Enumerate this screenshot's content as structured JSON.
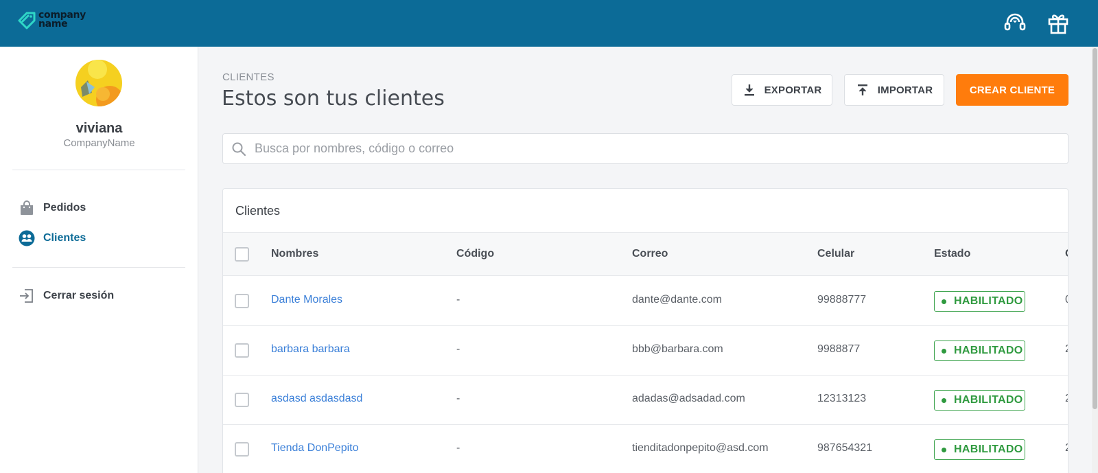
{
  "header": {
    "logo_line1": "company",
    "logo_line2": "name",
    "support_icon": "headset-icon",
    "gift_icon": "gift-icon",
    "bg_color": "#0c6b97"
  },
  "sidebar": {
    "user_name": "viviana",
    "company": "CompanyName",
    "items": [
      {
        "label": "Pedidos",
        "icon": "shopping-bag-icon"
      },
      {
        "label": "Clientes",
        "icon": "users-icon",
        "active": true
      },
      {
        "label": "Cerrar sesión",
        "icon": "logout-icon"
      }
    ]
  },
  "main": {
    "breadcrumb": "CLIENTES",
    "title": "Estos son tus clientes",
    "buttons": {
      "export": "EXPORTAR",
      "import": "IMPORTAR",
      "create": "CREAR CLIENTE"
    },
    "search_placeholder": "Busca por nombres, código o correo",
    "accent_color": "#ff7c0c"
  },
  "table": {
    "title": "Clientes",
    "columns": [
      "Nombres",
      "Código",
      "Correo",
      "Celular",
      "Estado",
      "C"
    ],
    "rows": [
      {
        "name": "Dante Morales",
        "code": "-",
        "email": "dante@dante.com",
        "phone": "99888777",
        "status": "HABILITADO",
        "extra": "0"
      },
      {
        "name": "barbara barbara",
        "code": "-",
        "email": "bbb@barbara.com",
        "phone": "9988877",
        "status": "HABILITADO",
        "extra": "2"
      },
      {
        "name": "asdasd asdasdasd",
        "code": "-",
        "email": "adadas@adsadad.com",
        "phone": "12313123",
        "status": "HABILITADO",
        "extra": "2"
      },
      {
        "name": "Tienda DonPepito",
        "code": "-",
        "email": "tienditadonpepito@asd.com",
        "phone": "987654321",
        "status": "HABILITADO",
        "extra": "2"
      }
    ],
    "status_color": "#2f9a3f"
  }
}
